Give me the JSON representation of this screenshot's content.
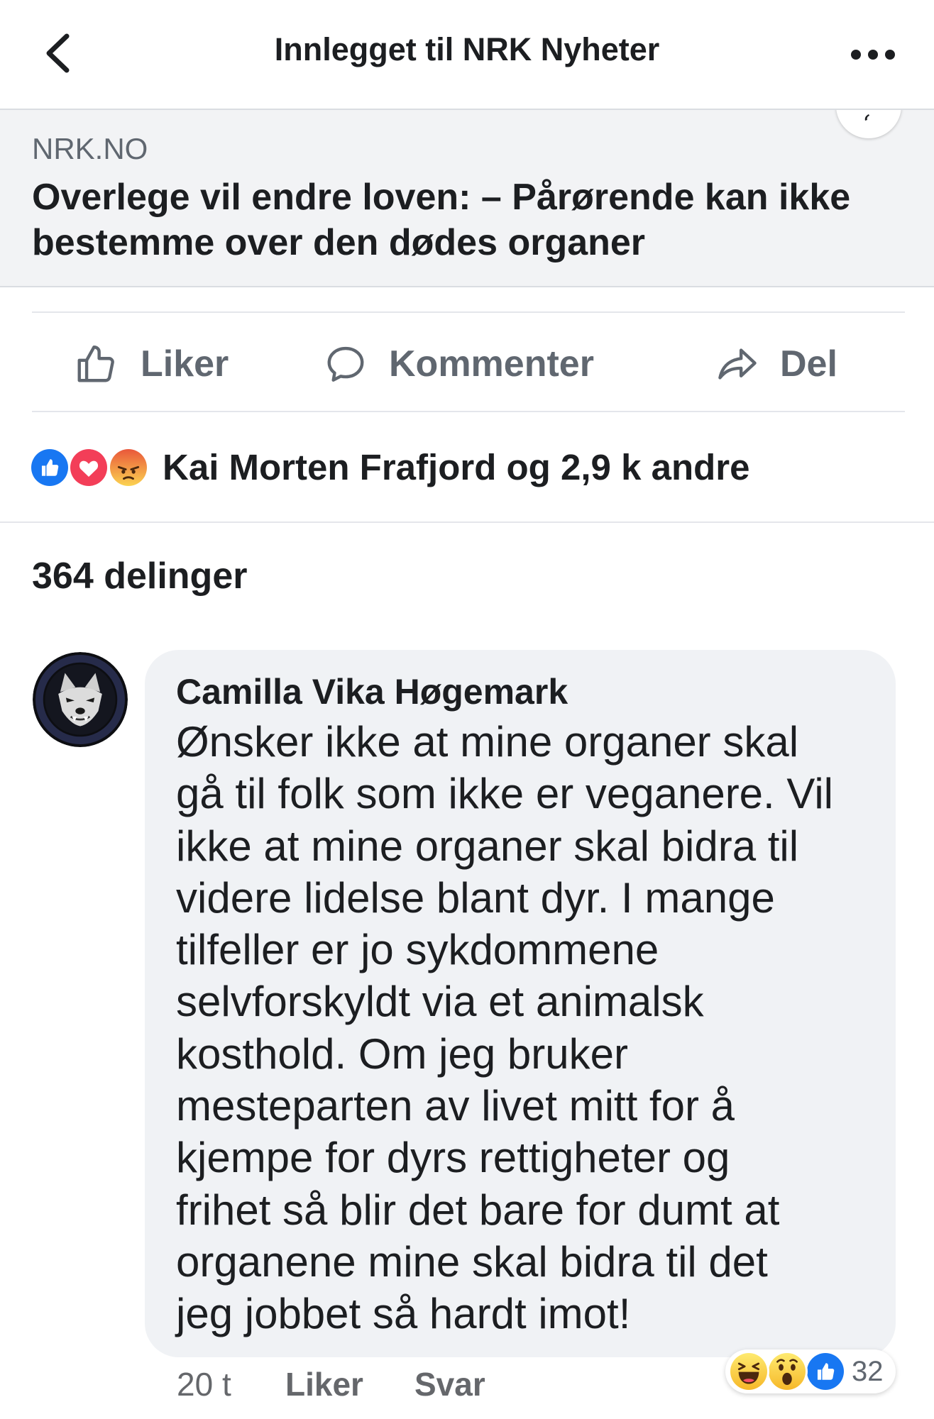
{
  "header": {
    "title": "Innlegget til NRK Nyheter",
    "back_icon": "chevron-left-icon",
    "more_icon": "more-dots-icon"
  },
  "link_preview": {
    "source": "NRK.NO",
    "headline_lines": [
      "Overlege vil endre loven: – Pårørende kan ikke",
      "bestemme over den dødes organer"
    ]
  },
  "actions": {
    "like": {
      "label": "Liker",
      "icon": "thumbs-up-icon"
    },
    "comment": {
      "label": "Kommenter",
      "icon": "comment-icon"
    },
    "share": {
      "label": "Del",
      "icon": "share-arrow-icon"
    }
  },
  "reactions": {
    "types": [
      "like",
      "love",
      "angry"
    ],
    "summary": "Kai Morten Frafjord og 2,9 k andre"
  },
  "shares": {
    "label": "364 delinger"
  },
  "comment": {
    "author": "Camilla Vika Høgemark",
    "body_lines": [
      "Ønsker ikke at mine organer skal",
      "gå til folk som ikke er veganere. Vil",
      "ikke at mine organer skal bidra til",
      "videre lidelse blant dyr. I mange",
      "tilfeller er jo sykdommene",
      "selvforskyldt via et animalsk",
      "kosthold. Om jeg bruker",
      "mesteparten av livet mitt for å",
      "kjempe for dyrs rettigheter og",
      "frihet så blir det bare for dumt at",
      "organene mine skal bidra til det",
      "jeg jobbet så hardt imot!"
    ],
    "time": "20 t",
    "like_label": "Liker",
    "reply_label": "Svar",
    "reaction_types": [
      "haha",
      "wow",
      "like"
    ],
    "reaction_count": "32"
  },
  "colors": {
    "text_primary": "#1c1e21",
    "text_secondary": "#606770",
    "like_blue": "#1877f2",
    "love_red": "#f33e58",
    "bubble_background": "#f0f2f5",
    "preview_background": "#f2f3f5"
  }
}
